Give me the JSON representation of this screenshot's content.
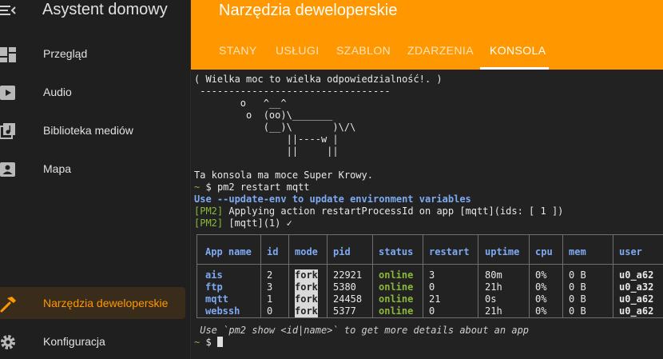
{
  "sidebar": {
    "app_title": "Asystent domowy",
    "items": [
      {
        "label": "Przegląd",
        "icon": "dashboard-icon"
      },
      {
        "label": "Audio",
        "icon": "play-box-icon"
      },
      {
        "label": "Biblioteka mediów",
        "icon": "music-library-icon"
      },
      {
        "label": "Mapa",
        "icon": "account-box-icon"
      },
      {
        "label": "Narzędzia deweloperskie",
        "icon": "hammer-icon",
        "active": true
      },
      {
        "label": "Konfiguracja",
        "icon": "gear-icon"
      }
    ]
  },
  "header": {
    "title": "Narzędzia deweloperskie",
    "tabs": [
      "STANY",
      "USŁUGI",
      "SZABLON",
      "ZDARZENIA",
      "KONSOLA"
    ],
    "active_tab": "KONSOLA",
    "accent_color": "#ff9800"
  },
  "console": {
    "cowsay": [
      "( Wielka moc to wielka odpowiedzialność!. )",
      " ---------------------------------",
      "        o   ^__^",
      "         o  (oo)\\_______",
      "            (__)\\       )\\/\\",
      "                ||----w |",
      "                ||     ||"
    ],
    "motd": "Ta konsola ma moce Super Krowy.",
    "prompt_symbol": "~",
    "prompt_dollar": "$",
    "command": "pm2 restart mqtt",
    "warning": "Use --update-env to update environment variables",
    "pm2_tag": "[PM2]",
    "pm2_line1": "Applying action restartProcessId on app [mqtt](ids: [ 1 ])",
    "pm2_line2": "[mqtt](1) ✓",
    "table": {
      "headers": [
        "App name",
        "id",
        "mode",
        "pid",
        "status",
        "restart",
        "uptime",
        "cpu",
        "mem",
        "user"
      ],
      "rows": [
        [
          "ais",
          "2",
          "fork",
          "22921",
          "online",
          "3",
          "80m",
          "0%",
          "0 B",
          "u0_a62"
        ],
        [
          "ftp",
          "3",
          "fork",
          "5380",
          "online",
          "0",
          "21h",
          "0%",
          "0 B",
          "u0_a32"
        ],
        [
          "mqtt",
          "1",
          "fork",
          "24458",
          "online",
          "21",
          "0s",
          "0%",
          "0 B",
          "u0_a62"
        ],
        [
          "webssh",
          "0",
          "fork",
          "5377",
          "online",
          "0",
          "21h",
          "0%",
          "0 B",
          "u0_a62"
        ]
      ]
    },
    "hint": " Use `pm2 show <id|name>` to get more details about an app"
  }
}
